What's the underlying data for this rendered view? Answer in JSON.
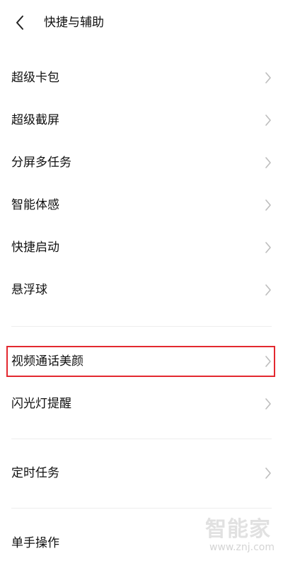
{
  "header": {
    "title": "快捷与辅助"
  },
  "sections": [
    {
      "items": [
        {
          "label": "超级卡包"
        },
        {
          "label": "超级截屏"
        },
        {
          "label": "分屏多任务"
        },
        {
          "label": "智能体感"
        },
        {
          "label": "快捷启动"
        },
        {
          "label": "悬浮球"
        }
      ]
    },
    {
      "items": [
        {
          "label": "视频通话美颜"
        },
        {
          "label": "闪光灯提醒"
        }
      ]
    },
    {
      "items": [
        {
          "label": "定时任务"
        }
      ]
    },
    {
      "items": [
        {
          "label": "单手操作"
        }
      ]
    }
  ],
  "highlight_color": "#e3282f",
  "watermark": {
    "text": "智能家",
    "url": "www.znj.com"
  }
}
